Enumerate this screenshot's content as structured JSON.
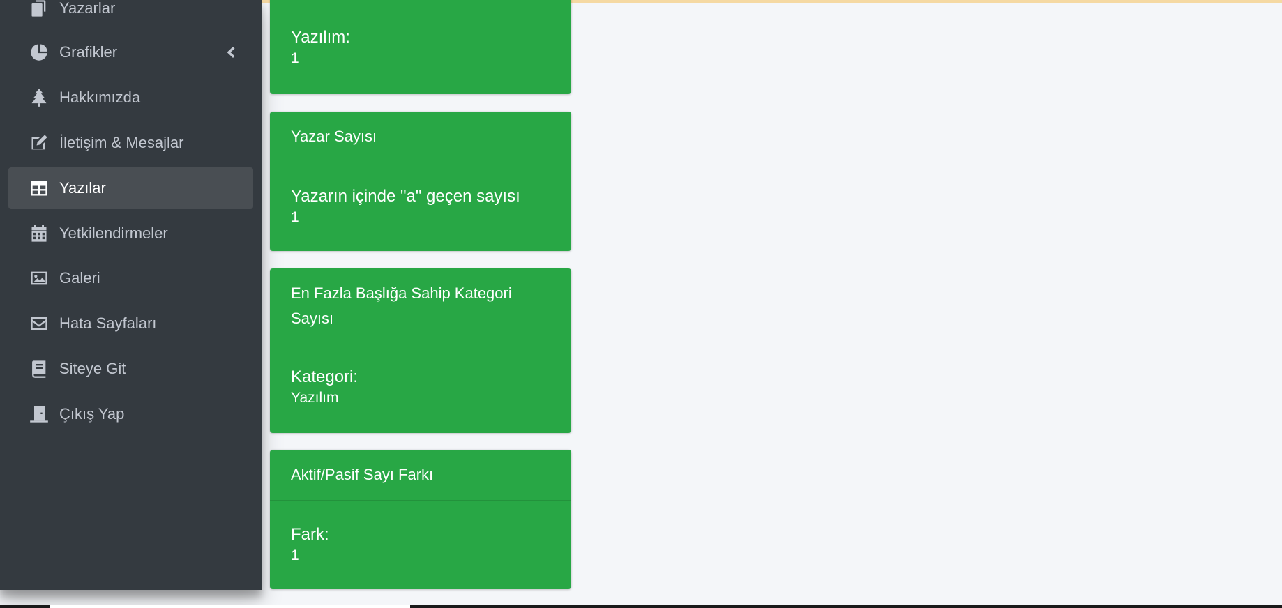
{
  "sidebar": {
    "items": [
      {
        "label": "Yazarlar",
        "icon": "copy-icon",
        "active": false
      },
      {
        "label": "Grafikler",
        "icon": "pie-chart-icon",
        "active": false,
        "has_chevron": true
      },
      {
        "label": "Hakkımızda",
        "icon": "tree-icon",
        "active": false
      },
      {
        "label": "İletişim & Mesajlar",
        "icon": "edit-icon",
        "active": false
      },
      {
        "label": "Yazılar",
        "icon": "table-icon",
        "active": true
      },
      {
        "label": "Yetkilendirmeler",
        "icon": "calendar-icon",
        "active": false
      },
      {
        "label": "Galeri",
        "icon": "image-icon",
        "active": false
      },
      {
        "label": "Hata Sayfaları",
        "icon": "envelope-icon",
        "active": false
      },
      {
        "label": "Siteye Git",
        "icon": "book-icon",
        "active": false
      },
      {
        "label": "Çıkış Yap",
        "icon": "door-icon",
        "active": false
      }
    ]
  },
  "cards": [
    {
      "header": "",
      "key": "Yazılım:",
      "value": "1"
    },
    {
      "header": "Yazar Sayısı",
      "key": "Yazarın içinde \"a\" geçen sayısı",
      "value": "1"
    },
    {
      "header": "En Fazla Başlığa Sahip Kategori Sayısı",
      "key": "Kategori:",
      "value": "Yazılım"
    },
    {
      "header": "Aktif/Pasif Sayı Farkı",
      "key": "Fark:",
      "value": "1"
    }
  ],
  "colors": {
    "sidebar_bg": "#343a40",
    "sidebar_active": "#494e53",
    "card_green": "#28a745",
    "page_bg": "#f4f6f9"
  }
}
